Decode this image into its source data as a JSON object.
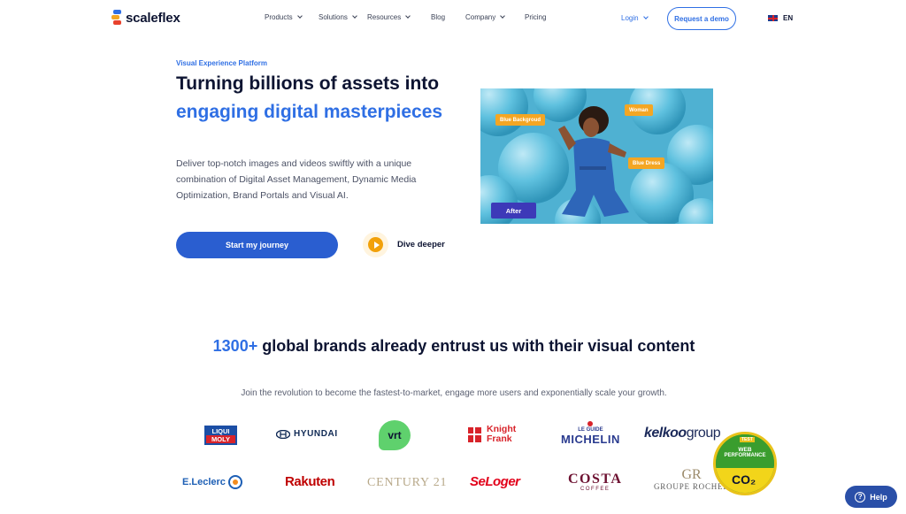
{
  "brand": {
    "name": "scaleflex"
  },
  "nav": {
    "items": [
      {
        "label": "Products",
        "has_dropdown": true
      },
      {
        "label": "Solutions",
        "has_dropdown": true
      },
      {
        "label": "Resources",
        "has_dropdown": true
      },
      {
        "label": "Blog",
        "has_dropdown": false
      },
      {
        "label": "Company",
        "has_dropdown": true
      },
      {
        "label": "Pricing",
        "has_dropdown": false
      }
    ],
    "login_label": "Login",
    "demo_label": "Request a demo",
    "language": "EN"
  },
  "hero": {
    "eyebrow": "Visual Experience Platform",
    "headline_part1": "Turning billions of assets into ",
    "headline_accent": "engaging digital masterpieces",
    "description": "Deliver top-notch images and videos swiftly with a unique combination of Digital Asset Management, Dynamic Media Optimization, Brand Portals and Visual AI.",
    "cta_label": "Start my journey",
    "secondary_label": "Dive deeper",
    "image_tags": [
      "Blue Backgroud",
      "Woman",
      "Blue Dress"
    ],
    "after_label": "After"
  },
  "brands": {
    "count": "1300+",
    "title_rest": " global brands already entrust us with their visual content",
    "subtitle": "Join the revolution to become the fastest-to-market, engage more users and exponentially scale your growth.",
    "logos": {
      "liqui_top": "LIQUI",
      "liqui_bottom": "MOLY",
      "hyundai": "HYUNDAI",
      "vrt": "vrt",
      "knight_1": "Knight",
      "knight_2": "Frank",
      "michelin_small": "LE GUIDE",
      "michelin": "MICHELIN",
      "kelkoo": "kelkoo",
      "kelkoo_rest": "group",
      "leclerc": "E.Leclerc",
      "rakuten": "Rakuten",
      "century": "CENTURY 21",
      "seloger": "SeLoger",
      "costa": "COSTA",
      "costa_small": "COFFEE",
      "rocher_mono": "GR",
      "rocher": "GROUPE ROCHER"
    }
  },
  "badge": {
    "test": "TEST",
    "web": "WEB",
    "performance": "PERFORMANCE",
    "co2": "CO₂"
  },
  "help": {
    "label": "Help"
  },
  "colors": {
    "accent": "#2f6fe4",
    "cta": "#2a5ed0",
    "dark": "#0d1432",
    "tag": "#f4a623"
  }
}
